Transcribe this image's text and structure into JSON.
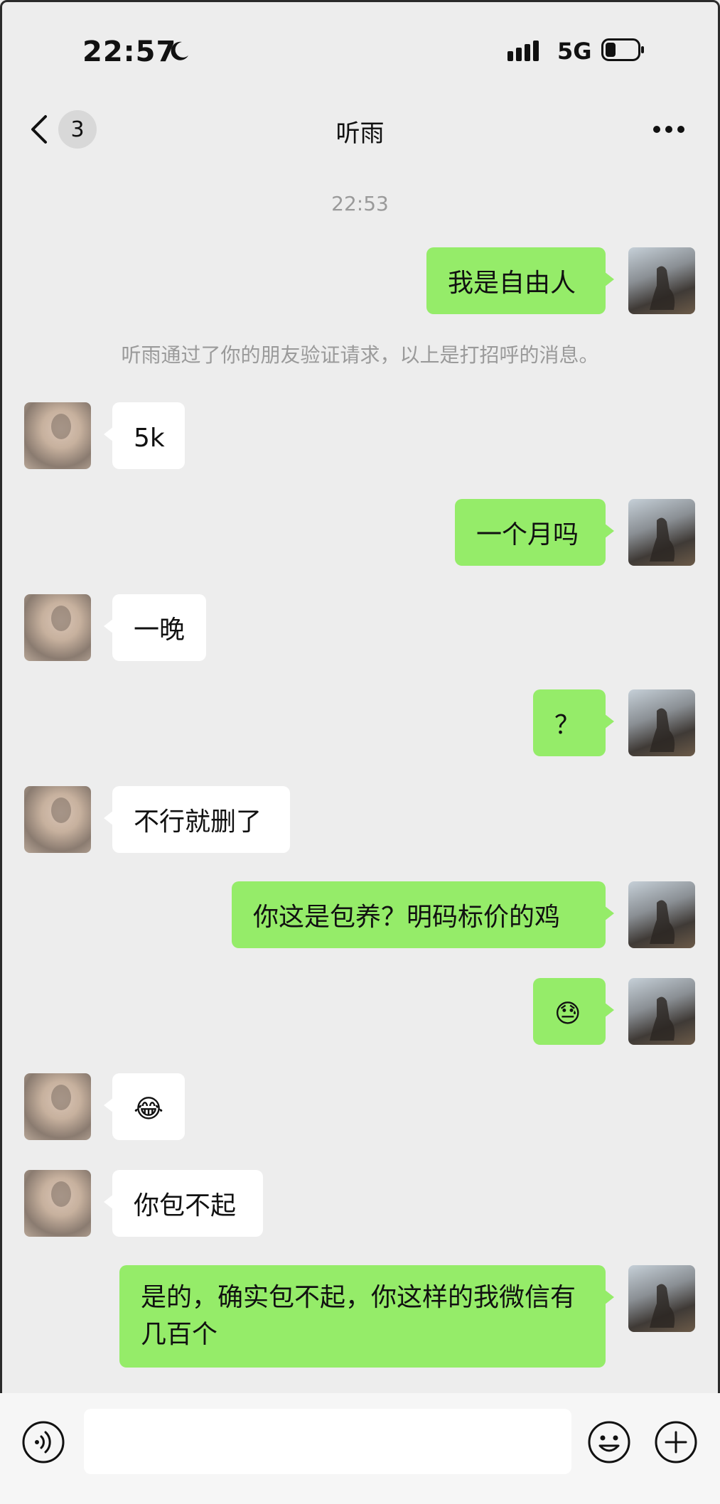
{
  "status_bar": {
    "time": "22:57",
    "network": "5G"
  },
  "nav": {
    "unread_count": "3",
    "title": "听雨"
  },
  "timestamp": "22:53",
  "system_message": "听雨通过了你的朋友验证请求，以上是打招呼的消息。",
  "messages": [
    {
      "from": "me",
      "text": "我是自由人"
    },
    {
      "from": "her",
      "text": "5k"
    },
    {
      "from": "me",
      "text": "一个月吗"
    },
    {
      "from": "her",
      "text": "一晚"
    },
    {
      "from": "me",
      "text": "？"
    },
    {
      "from": "her",
      "text": "不行就删了"
    },
    {
      "from": "me",
      "text": "你这是包养？明码标价的鸡"
    },
    {
      "from": "me",
      "text": "😓"
    },
    {
      "from": "her",
      "text": "😂"
    },
    {
      "from": "her",
      "text": "你包不起"
    },
    {
      "from": "me",
      "text": "是的，确实包不起，你这样的我微信有几百个"
    }
  ],
  "colors": {
    "background": "#ededed",
    "outgoing_bubble": "#95ec69",
    "incoming_bubble": "#ffffff",
    "muted_text": "#9a9a9a"
  }
}
